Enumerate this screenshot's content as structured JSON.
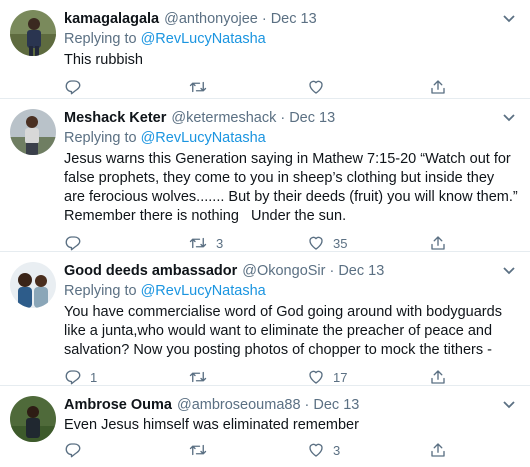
{
  "colors": {
    "accent": "#1b95e0",
    "muted": "#5b7083",
    "text": "#0f1419",
    "divider": "#e6ecf0"
  },
  "tweets": [
    {
      "name": "kamagalagala",
      "handle": "@anthonyojee",
      "separator": "·",
      "date": "Dec 13",
      "replying_prefix": "Replying to ",
      "replying_to": "@RevLucyNatasha",
      "text": "This rubbish",
      "replies": "",
      "retweets": "",
      "likes": ""
    },
    {
      "name": "Meshack Keter",
      "handle": "@ketermeshack",
      "separator": "·",
      "date": "Dec 13",
      "replying_prefix": "Replying to ",
      "replying_to": "@RevLucyNatasha",
      "text": "Jesus warns this Generation saying in Mathew 7:15-20 “Watch out for false prophets, they come to you in sheep’s clothing but inside they are ferocious wolves....... But by their deeds (fruit) you will know them.” Remember there is nothing   Under the sun.",
      "replies": "",
      "retweets": "3",
      "likes": "35"
    },
    {
      "name": "Good deeds ambassador",
      "handle": "@OkongoSir",
      "separator": "·",
      "date": "Dec 13",
      "replying_prefix": "Replying to ",
      "replying_to": "@RevLucyNatasha",
      "text": "You have commercialise word of God going around with bodyguards like a junta,who would want to eliminate the preacher of peace and salvation? Now you posting photos of chopper to mock the tithers -",
      "replies": "1",
      "retweets": "",
      "likes": "17"
    },
    {
      "name": "Ambrose Ouma",
      "handle": "@ambroseouma88",
      "separator": "·",
      "date": "Dec 13",
      "text": "Even Jesus himself was eliminated remember",
      "replies": "",
      "retweets": "",
      "likes": "3"
    }
  ],
  "icons": {
    "reply": "reply-icon",
    "retweet": "retweet-icon",
    "like": "heart-icon",
    "share": "share-icon",
    "more": "chevron-down-icon"
  }
}
